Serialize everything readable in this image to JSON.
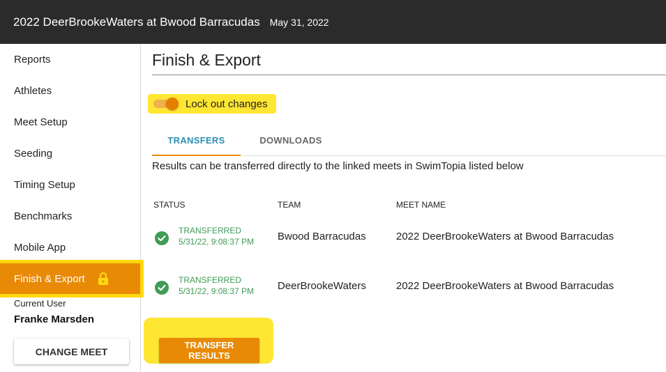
{
  "header": {
    "title": "2022 DeerBrookeWaters at Bwood Barracudas",
    "date": "May 31, 2022"
  },
  "sidebar": {
    "items": [
      {
        "label": "Reports"
      },
      {
        "label": "Athletes"
      },
      {
        "label": "Meet Setup"
      },
      {
        "label": "Seeding"
      },
      {
        "label": "Timing Setup"
      },
      {
        "label": "Benchmarks"
      },
      {
        "label": "Mobile App"
      },
      {
        "label": "Finish & Export",
        "active": true
      }
    ],
    "current_user_label": "Current User",
    "current_user_name": "Franke Marsden",
    "change_meet_label": "CHANGE MEET"
  },
  "main": {
    "page_title": "Finish & Export",
    "lock_toggle": {
      "label": "Lock out changes",
      "on": true
    },
    "tabs": [
      {
        "label": "TRANSFERS",
        "active": true
      },
      {
        "label": "DOWNLOADS",
        "active": false
      }
    ],
    "description": "Results can be transferred directly to the linked meets in SwimTopia listed below",
    "table": {
      "headers": {
        "status": "STATUS",
        "team": "TEAM",
        "meet": "MEET NAME"
      },
      "rows": [
        {
          "status": "TRANSFERRED",
          "timestamp": "5/31/22, 9:08:37 PM",
          "team": "Bwood Barracudas",
          "meet": "2022 DeerBrookeWaters at Bwood Barracudas"
        },
        {
          "status": "TRANSFERRED",
          "timestamp": "5/31/22, 9:08:37 PM",
          "team": "DeerBrookeWaters",
          "meet": "2022 DeerBrookeWaters at Bwood Barracudas"
        }
      ]
    },
    "transfer_button_label": "TRANSFER RESULTS"
  },
  "colors": {
    "accent": "#e88a06",
    "tab_active": "#2c8fb3",
    "success": "#3f9b56",
    "highlight": "#ffe633",
    "topbar": "#2b2b2b"
  }
}
